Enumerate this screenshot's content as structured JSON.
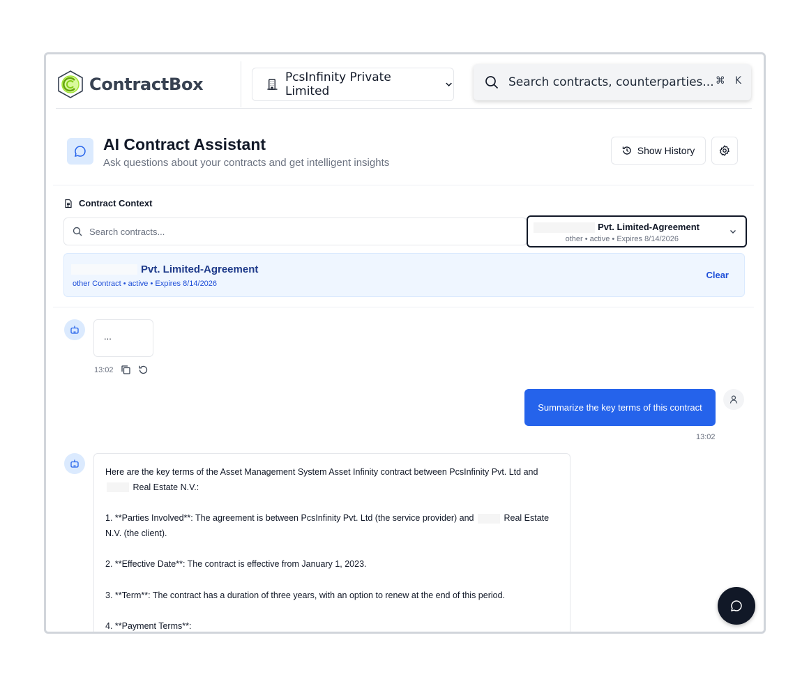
{
  "brand": {
    "name": "ContractBox"
  },
  "topbar": {
    "org_name": "PcsInfinity Private Limited",
    "search_placeholder": "Search contracts, counterparties...",
    "shortcut_mod": "⌘",
    "shortcut_key": "K"
  },
  "assistant": {
    "title": "AI Contract Assistant",
    "subtitle": "Ask questions about your contracts and get intelligent insights",
    "history_label": "Show History"
  },
  "context": {
    "label": "Contract Context",
    "search_placeholder": "Search contracts...",
    "selected_name": "Pvt. Limited-Agreement",
    "selected_meta": "other • active • Expires 8/14/2026",
    "card_name": "Pvt. Limited-Agreement",
    "card_meta": "other Contract • active • Expires 8/14/2026",
    "clear_label": "Clear"
  },
  "messages": {
    "typing_text": "...",
    "typing_time": "13:02",
    "user_text": "Summarize the key terms of this contract",
    "user_time": "13:02",
    "answer": {
      "p1a": "Here are the key terms of the Asset Management System Asset Infinity contract between PcsInfinity Pvt. Ltd and",
      "p1b": "Real Estate N.V.:",
      "p2a": "1. **Parties Involved**: The agreement is between PcsInfinity Pvt. Ltd (the service provider) and",
      "p2b": "Real Estate N.V. (the client).",
      "p3": "2. **Effective Date**: The contract is effective from January 1, 2023.",
      "p4": "3. **Term**: The contract has a duration of three years, with an option to renew at the end of this period.",
      "p5": "4. **Payment Terms**:"
    }
  },
  "colors": {
    "primary": "#2563eb",
    "dark": "#111827",
    "light_blue": "#eff6ff"
  }
}
